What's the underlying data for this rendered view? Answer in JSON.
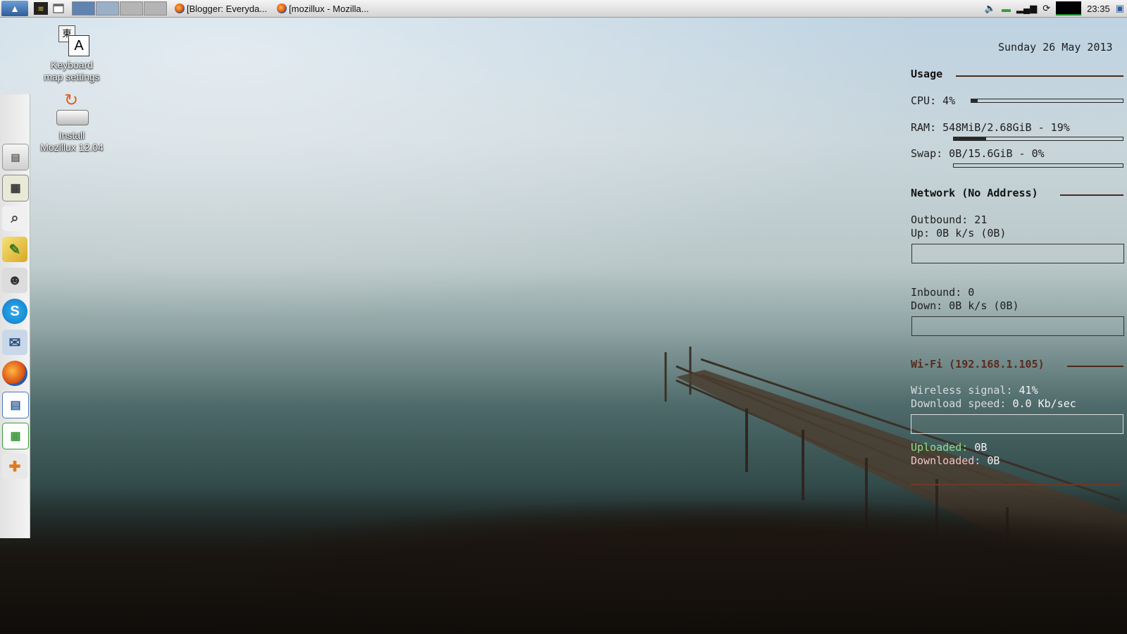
{
  "panel": {
    "workspaces": [
      "1",
      "2",
      "3",
      "4"
    ],
    "tasks": [
      {
        "label": "[Blogger: Everyda..."
      },
      {
        "label": "[mozillux - Mozilla..."
      }
    ],
    "clock": "23:35"
  },
  "desktop": {
    "icons": [
      {
        "line1": "Keyboard",
        "line2": "map settings"
      },
      {
        "line1": "Install",
        "line2": "Mozillux 12.04"
      }
    ]
  },
  "dock": {
    "items": [
      "file-manager",
      "calculator",
      "search",
      "text-editor",
      "contacts",
      "skype",
      "mail",
      "firefox",
      "writer",
      "calc",
      "extensions"
    ]
  },
  "conky": {
    "date": "Sunday 26 May 2013",
    "usage_header": "Usage",
    "cpu": "CPU: 4%",
    "cpu_percent": 4,
    "ram": "RAM:  548MiB/2.68GiB - 19%",
    "ram_percent": 19,
    "swap": "Swap: 0B/15.6GiB - 0%",
    "swap_percent": 0,
    "network_header": "Network (No Address)",
    "outbound": "Outbound: 21",
    "up": "Up: 0B k/s (0B)",
    "inbound": "Inbound: 0",
    "down": "Down: 0B k/s (0B)",
    "wifi_header": "Wi-Fi (192.168.1.105)",
    "wireless_signal_label": "Wireless signal:",
    "wireless_signal_value": "41%",
    "download_speed_label": "Download speed:",
    "download_speed_value": "0.0 Kb/sec",
    "uploaded_label": "Uploaded:",
    "uploaded_value": "0B",
    "downloaded_label": "Downloaded:",
    "downloaded_value": "0B"
  },
  "colors": {
    "conky_rule": "#4a2a1c",
    "uploaded": "#8fe08a",
    "downloaded": "#f1c4c4"
  }
}
